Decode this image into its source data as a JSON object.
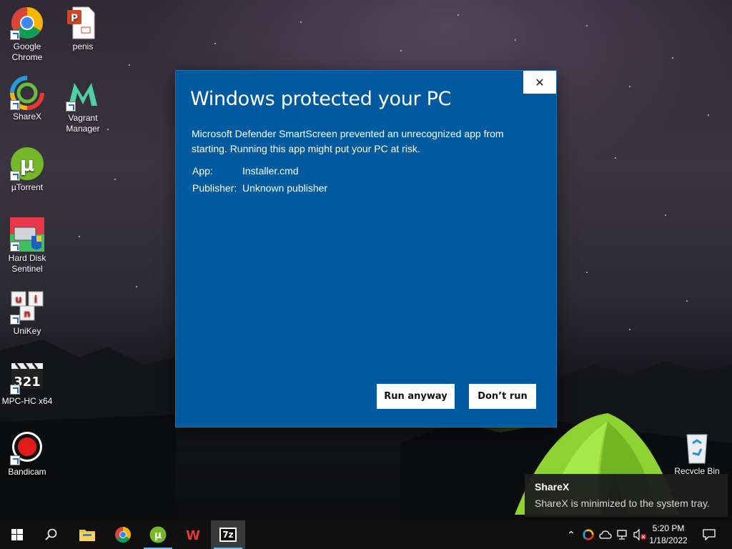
{
  "desktop": {
    "icons": [
      {
        "label": "Google\nChrome",
        "icon": "chrome-icon"
      },
      {
        "label": "penis",
        "icon": "document-icon"
      },
      {
        "label": "ShareX",
        "icon": "sharex-icon"
      },
      {
        "label": "Vagrant\nManager",
        "icon": "vagrant-manager-icon"
      },
      {
        "label": "µTorrent",
        "icon": "utorrent-icon"
      },
      {
        "label": "Hard Disk\nSentinel",
        "icon": "hard-disk-sentinel-icon"
      },
      {
        "label": "UniKey",
        "icon": "unikey-icon"
      },
      {
        "label": "MPC-HC x64",
        "icon": "mpc-hc-icon"
      },
      {
        "label": "Bandicam",
        "icon": "bandicam-icon"
      },
      {
        "label": "Recycle Bin",
        "icon": "recycle-bin-icon"
      }
    ]
  },
  "dialog": {
    "title": "Windows protected your PC",
    "message": "Microsoft Defender SmartScreen prevented an unrecognized app from starting. Running this app might put your PC at risk.",
    "app_label": "App:",
    "app_value": "Installer.cmd",
    "publisher_label": "Publisher:",
    "publisher_value": "Unknown publisher",
    "run_anyway": "Run anyway",
    "dont_run": "Don’t run",
    "close_glyph": "✕",
    "color": "#005aa0"
  },
  "notification": {
    "title": "ShareX",
    "body": "ShareX is minimized to the system tray."
  },
  "taskbar": {
    "pinned": [
      "start-icon",
      "search-icon",
      "file-explorer-icon",
      "chrome-icon",
      "utorrent-icon",
      "wps-office-icon",
      "7zip-icon"
    ],
    "sevenzip_label": "7z",
    "wps_label": "W",
    "time": "5:20 PM",
    "date": "1/18/2022",
    "tray_icons": [
      "chevron-up-icon",
      "sharex-tray-icon",
      "onedrive-icon",
      "network-icon",
      "volume-muted-icon"
    ],
    "tray_chevron": "⌃"
  }
}
